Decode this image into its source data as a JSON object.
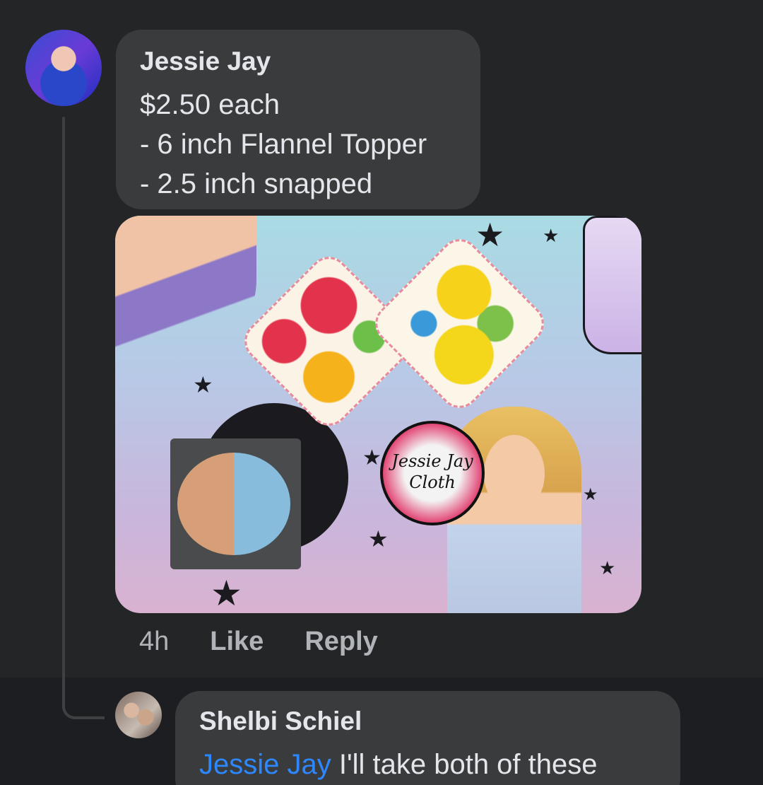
{
  "comments": [
    {
      "author": "Jessie Jay",
      "lines": [
        "$2.50 each",
        "- 6 inch Flannel Topper",
        "- 2.5 inch snapped"
      ],
      "photo": {
        "logo_text_1": "Jessie Jay",
        "logo_text_2": "Cloth"
      },
      "actions": {
        "time": "4h",
        "like": "Like",
        "reply": "Reply"
      }
    },
    {
      "author": "Shelbi Schiel",
      "mention": "Jessie Jay",
      "text": " I'll take both of these"
    }
  ],
  "colors": {
    "background": "#242526",
    "bubble": "#3a3b3c",
    "text": "#e4e6eb",
    "secondary_text": "#b0b3b8",
    "mention": "#2d88ff"
  }
}
